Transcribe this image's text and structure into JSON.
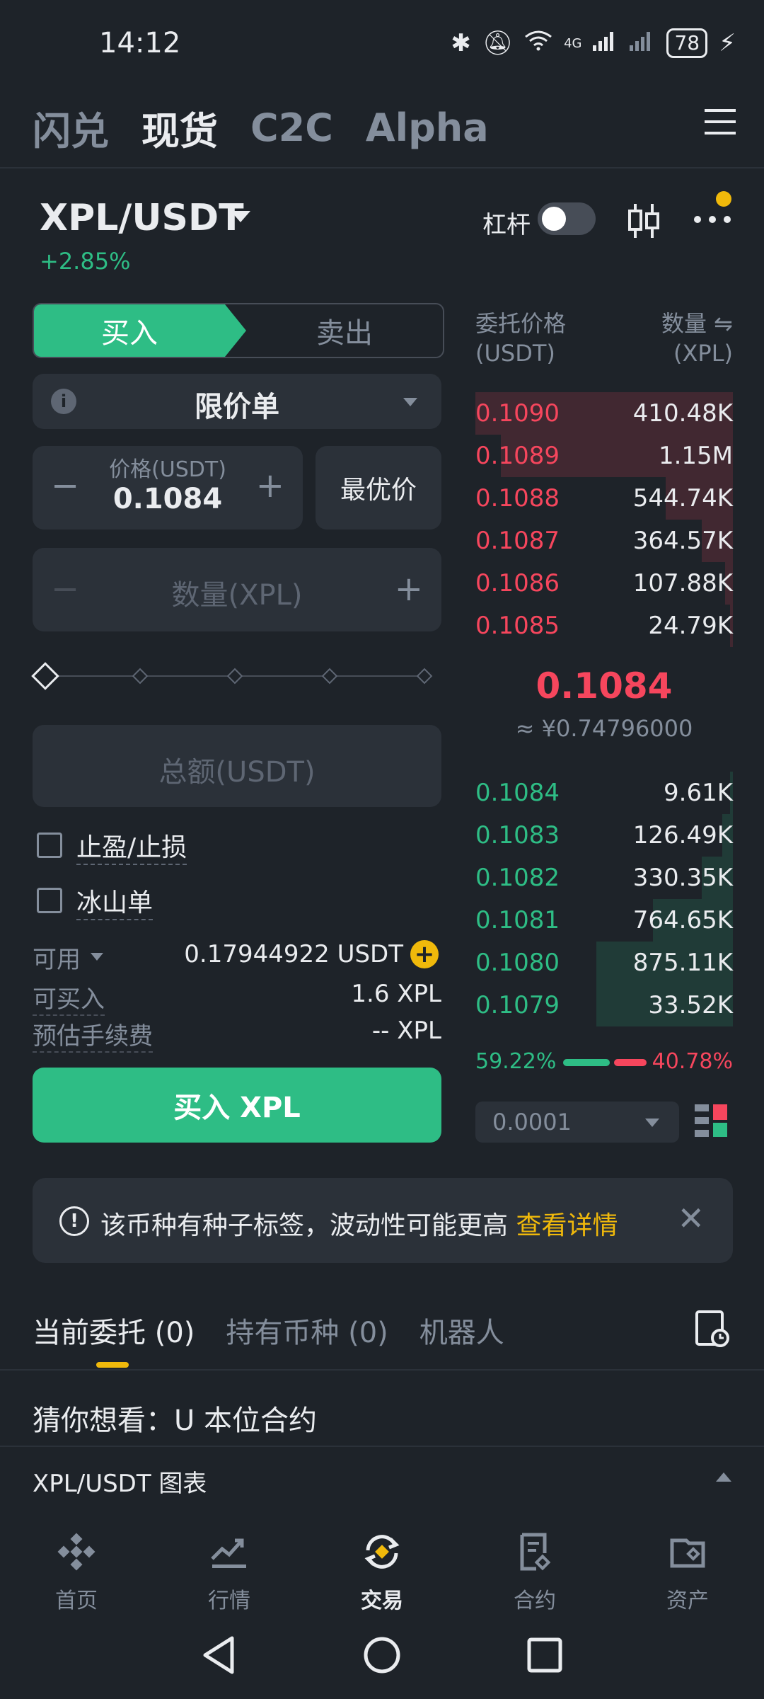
{
  "status": {
    "time": "14:12",
    "battery": "78",
    "network": "4G"
  },
  "top_tabs": [
    {
      "label": "闪兑",
      "active": false
    },
    {
      "label": "现货",
      "active": true
    },
    {
      "label": "C2C",
      "active": false
    },
    {
      "label": "Alpha",
      "active": false
    }
  ],
  "pair": {
    "symbol": "XPL/USDT",
    "change": "+2.85%",
    "leverage_label": "杠杆"
  },
  "trade": {
    "buy_tab": "买入",
    "sell_tab": "卖出",
    "order_type": "限价单",
    "price_label": "价格(USDT)",
    "price_value": "0.1084",
    "best_price": "最优价",
    "qty_placeholder": "数量(XPL)",
    "total_placeholder": "总额(USDT)",
    "tp_sl": "止盈/止损",
    "iceberg": "冰山单",
    "available_label": "可用",
    "available_value": "0.17944922 USDT",
    "can_buy_label": "可买入",
    "can_buy_value": "1.6 XPL",
    "fee_label": "预估手续费",
    "fee_value": "-- XPL",
    "buy_button": "买入 XPL"
  },
  "orderbook": {
    "price_header": "委托价格",
    "price_unit": "(USDT)",
    "qty_header": "数量 ⇋",
    "qty_unit": "(XPL)",
    "asks": [
      {
        "price": "0.1090",
        "qty": "410.48K",
        "depth": 1.0
      },
      {
        "price": "0.1089",
        "qty": "1.15M",
        "depth": 0.9
      },
      {
        "price": "0.1088",
        "qty": "544.74K",
        "depth": 0.26
      },
      {
        "price": "0.1087",
        "qty": "364.57K",
        "depth": 0.12
      },
      {
        "price": "0.1086",
        "qty": "107.88K",
        "depth": 0.03
      },
      {
        "price": "0.1085",
        "qty": "24.79K",
        "depth": 0.01
      }
    ],
    "last_price": "0.1084",
    "last_price_cny": "≈ ¥0.74796000",
    "bids": [
      {
        "price": "0.1084",
        "qty": "9.61K",
        "depth": 0.01
      },
      {
        "price": "0.1083",
        "qty": "126.49K",
        "depth": 0.04
      },
      {
        "price": "0.1082",
        "qty": "330.35K",
        "depth": 0.12
      },
      {
        "price": "0.1081",
        "qty": "764.65K",
        "depth": 0.31
      },
      {
        "price": "0.1080",
        "qty": "875.11K",
        "depth": 0.53
      },
      {
        "price": "0.1079",
        "qty": "33.52K",
        "depth": 0.53
      }
    ],
    "buy_ratio": "59.22%",
    "sell_ratio": "40.78%",
    "precision": "0.0001"
  },
  "alert": {
    "text": "该币种有种子标签，波动性可能更高",
    "link": "查看详情"
  },
  "bottom_tabs": [
    {
      "label": "当前委托 (0)",
      "active": true
    },
    {
      "label": "持有币种 (0)",
      "active": false
    },
    {
      "label": "机器人",
      "active": false
    }
  ],
  "guess": "猜你想看：U 本位合约",
  "chart_row": "XPL/USDT 图表",
  "nav": [
    {
      "label": "首页",
      "icon": "binance-logo-icon",
      "active": false
    },
    {
      "label": "行情",
      "icon": "chart-icon",
      "active": false
    },
    {
      "label": "交易",
      "icon": "trade-icon",
      "active": true
    },
    {
      "label": "合约",
      "icon": "contract-icon",
      "active": false
    },
    {
      "label": "资产",
      "icon": "wallet-icon",
      "active": false
    }
  ],
  "colors": {
    "green": "#2EBD85",
    "red": "#F6465D",
    "accent": "#F0B90B",
    "bg": "#1E2329"
  }
}
